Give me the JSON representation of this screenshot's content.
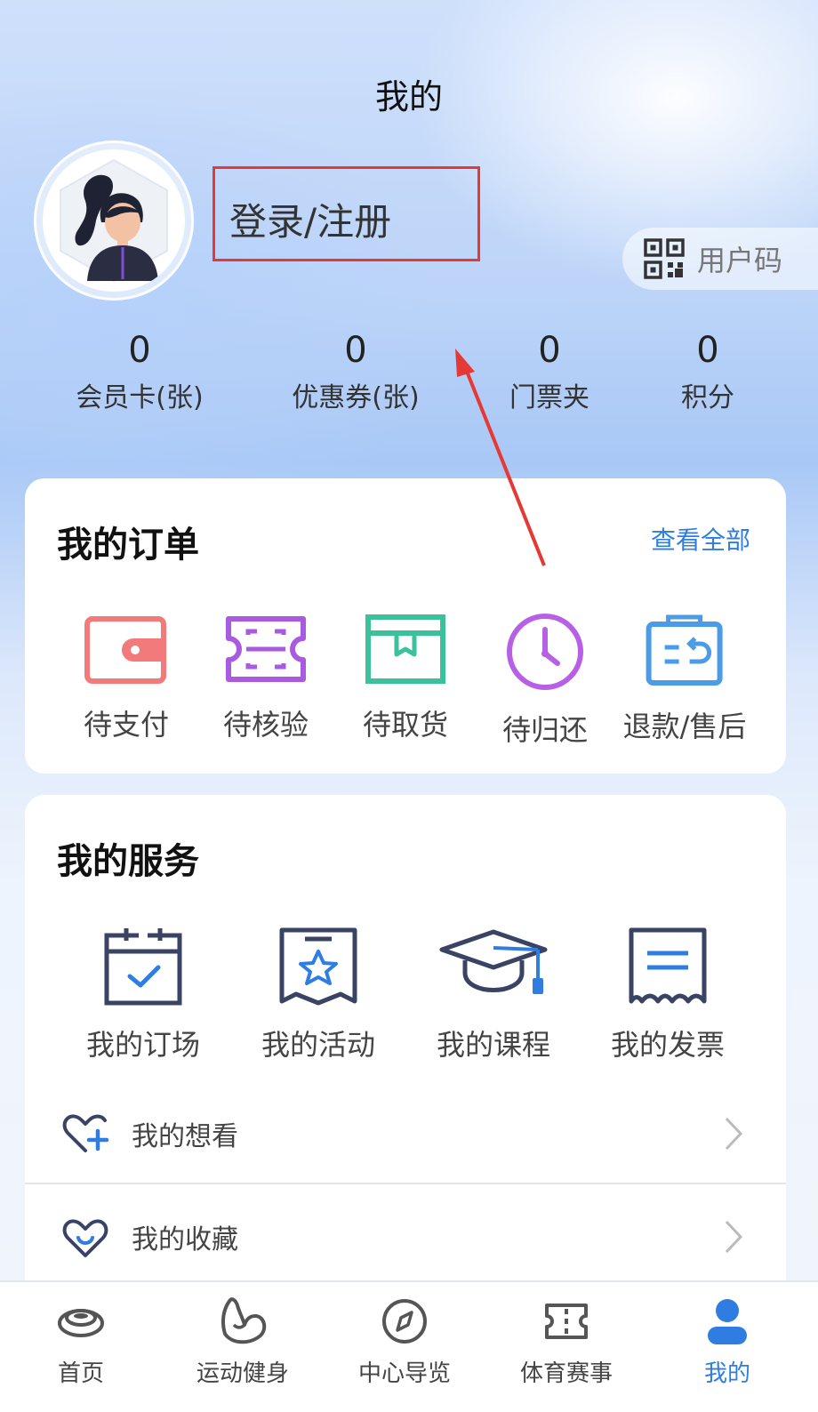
{
  "header": {
    "title": "我的"
  },
  "profile": {
    "login_label": "登录/注册",
    "usercode_label": "用户码"
  },
  "stats": [
    {
      "value": "0",
      "label": "会员卡(张)"
    },
    {
      "value": "0",
      "label": "优惠券(张)"
    },
    {
      "value": "0",
      "label": "门票夹"
    },
    {
      "value": "0",
      "label": "积分"
    }
  ],
  "orders": {
    "title": "我的订单",
    "view_all": "查看全部",
    "items": [
      {
        "label": "待支付",
        "icon": "wallet-icon",
        "color": "#f27a7a"
      },
      {
        "label": "待核验",
        "icon": "ticket-scan-icon",
        "color": "#a85be0"
      },
      {
        "label": "待取货",
        "icon": "box-icon",
        "color": "#3cc29b"
      },
      {
        "label": "待归还",
        "icon": "clock-icon",
        "color": "#b760e6"
      },
      {
        "label": "退款/售后",
        "icon": "refund-icon",
        "color": "#4a9be8"
      }
    ]
  },
  "services": {
    "title": "我的服务",
    "items": [
      {
        "label": "我的订场",
        "icon": "calendar-check-icon"
      },
      {
        "label": "我的活动",
        "icon": "star-badge-icon"
      },
      {
        "label": "我的课程",
        "icon": "graduation-cap-icon"
      },
      {
        "label": "我的发票",
        "icon": "invoice-icon"
      }
    ],
    "list": [
      {
        "label": "我的想看",
        "icon": "heart-plus-icon"
      },
      {
        "label": "我的收藏",
        "icon": "heart-check-icon"
      }
    ]
  },
  "tabbar": {
    "items": [
      {
        "label": "首页",
        "icon": "home-disc-icon",
        "active": false
      },
      {
        "label": "运动健身",
        "icon": "muscle-icon",
        "active": false
      },
      {
        "label": "中心导览",
        "icon": "compass-icon",
        "active": false
      },
      {
        "label": "体育赛事",
        "icon": "event-ticket-icon",
        "active": false
      },
      {
        "label": "我的",
        "icon": "user-icon",
        "active": true
      }
    ]
  },
  "colors": {
    "accent": "#2f7de1",
    "annotation_red": "#e53935",
    "service_icon": "#3a4363",
    "service_accent": "#2f7de1"
  }
}
